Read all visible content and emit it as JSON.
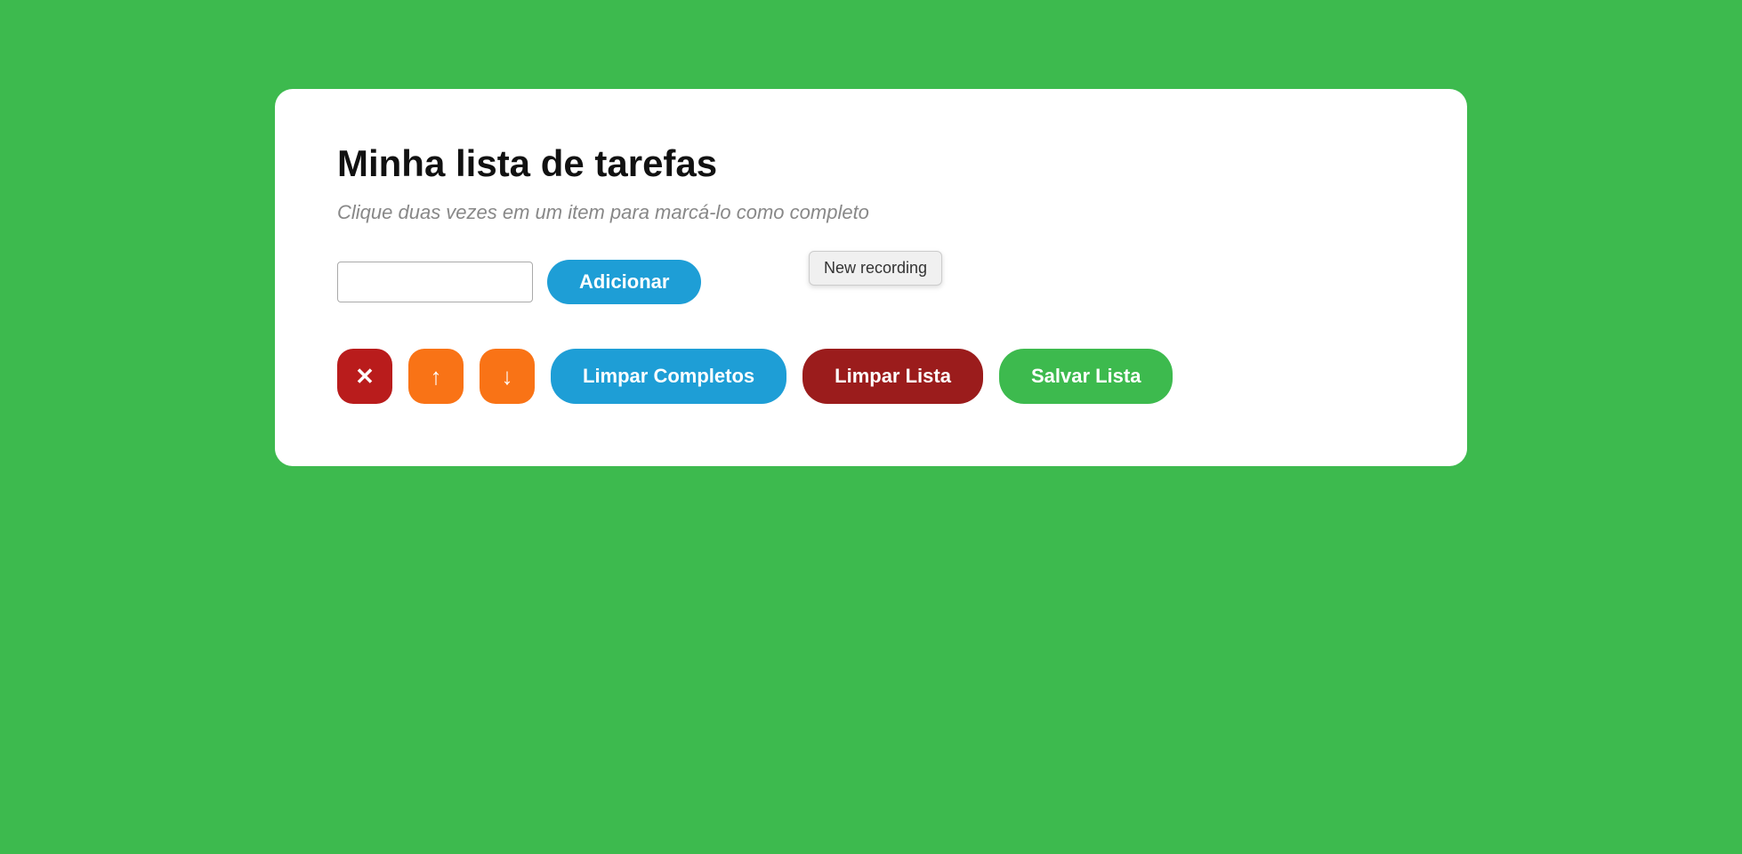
{
  "page": {
    "background_color": "#3dba4e"
  },
  "card": {
    "title": "Minha lista de tarefas",
    "subtitle": "Clique duas vezes em um item para marcá-lo como completo"
  },
  "input": {
    "placeholder": "",
    "value": ""
  },
  "buttons": {
    "add_label": "Adicionar",
    "clear_completed_label": "Limpar Completos",
    "clear_list_label": "Limpar Lista",
    "save_list_label": "Salvar Lista",
    "delete_icon": "✕",
    "up_icon": "↑",
    "down_icon": "↓"
  },
  "tooltip": {
    "text": "New recording"
  }
}
